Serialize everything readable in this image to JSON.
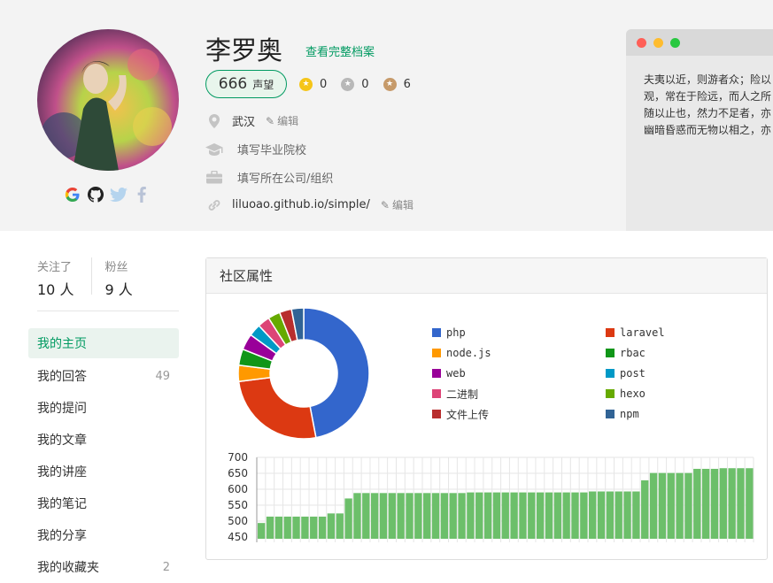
{
  "profile": {
    "name": "李罗奥",
    "full_profile_link": "查看完整档案",
    "reputation_value": "666",
    "reputation_label": "声望",
    "badges": [
      {
        "icon": "gold-badge-icon",
        "color": "#f5c518",
        "count": "0"
      },
      {
        "icon": "silver-badge-icon",
        "color": "#b8b8b8",
        "count": "0"
      },
      {
        "icon": "bronze-badge-icon",
        "color": "#c69a6a",
        "count": "6"
      }
    ],
    "city": "武汉",
    "city_edit": "编辑",
    "school_placeholder": "填写毕业院校",
    "company_placeholder": "填写所在公司/组织",
    "website": "liluoao.github.io/simple/",
    "website_edit": "编辑",
    "social": [
      "google-icon",
      "github-icon",
      "twitter-icon",
      "facebook-icon"
    ]
  },
  "intro_window": {
    "lines": [
      "夫夷以近，则游者众；险以",
      "观，常在于险远，而人之所",
      "随以止也，然力不足者，亦",
      "幽暗昏惑而无物以相之，亦"
    ]
  },
  "stats": {
    "following_label": "关注了",
    "following_value": "10 人",
    "followers_label": "粉丝",
    "followers_value": "9 人"
  },
  "nav": [
    {
      "label": "我的主页",
      "count": "",
      "active": true
    },
    {
      "label": "我的回答",
      "count": "49"
    },
    {
      "label": "我的提问",
      "count": ""
    },
    {
      "label": "我的文章",
      "count": ""
    },
    {
      "label": "我的讲座",
      "count": ""
    },
    {
      "label": "我的笔记",
      "count": ""
    },
    {
      "label": "我的分享",
      "count": ""
    },
    {
      "label": "我的收藏夹",
      "count": "2"
    }
  ],
  "panel": {
    "title": "社区属性"
  },
  "colors": {
    "accent": "#009a61",
    "bar": "#6cbf6a"
  },
  "chart_data": [
    {
      "type": "pie",
      "legend": [
        "php",
        "laravel",
        "node.js",
        "rbac",
        "web",
        "post",
        "二进制",
        "hexo",
        "文件上传",
        "npm"
      ],
      "colors": [
        "#3366cc",
        "#dc3912",
        "#ff9900",
        "#109618",
        "#990099",
        "#0099c6",
        "#dd4477",
        "#66aa00",
        "#b82e2e",
        "#316395"
      ],
      "values": [
        47,
        26,
        4,
        4,
        4,
        3,
        3,
        3,
        3,
        3
      ]
    },
    {
      "type": "bar",
      "ylim": [
        450,
        700
      ],
      "yticks": [
        700,
        650,
        600,
        550,
        500,
        450
      ],
      "values": [
        494,
        514,
        514,
        514,
        514,
        514,
        514,
        514,
        524,
        524,
        571,
        588,
        588,
        588,
        588,
        588,
        588,
        588,
        588,
        588,
        588,
        588,
        588,
        588,
        590,
        590,
        590,
        590,
        590,
        590,
        590,
        590,
        590,
        590,
        590,
        590,
        590,
        590,
        593,
        593,
        593,
        593,
        593,
        593,
        628,
        651,
        651,
        651,
        651,
        651,
        664,
        664,
        664,
        666,
        666,
        666,
        666
      ]
    }
  ]
}
